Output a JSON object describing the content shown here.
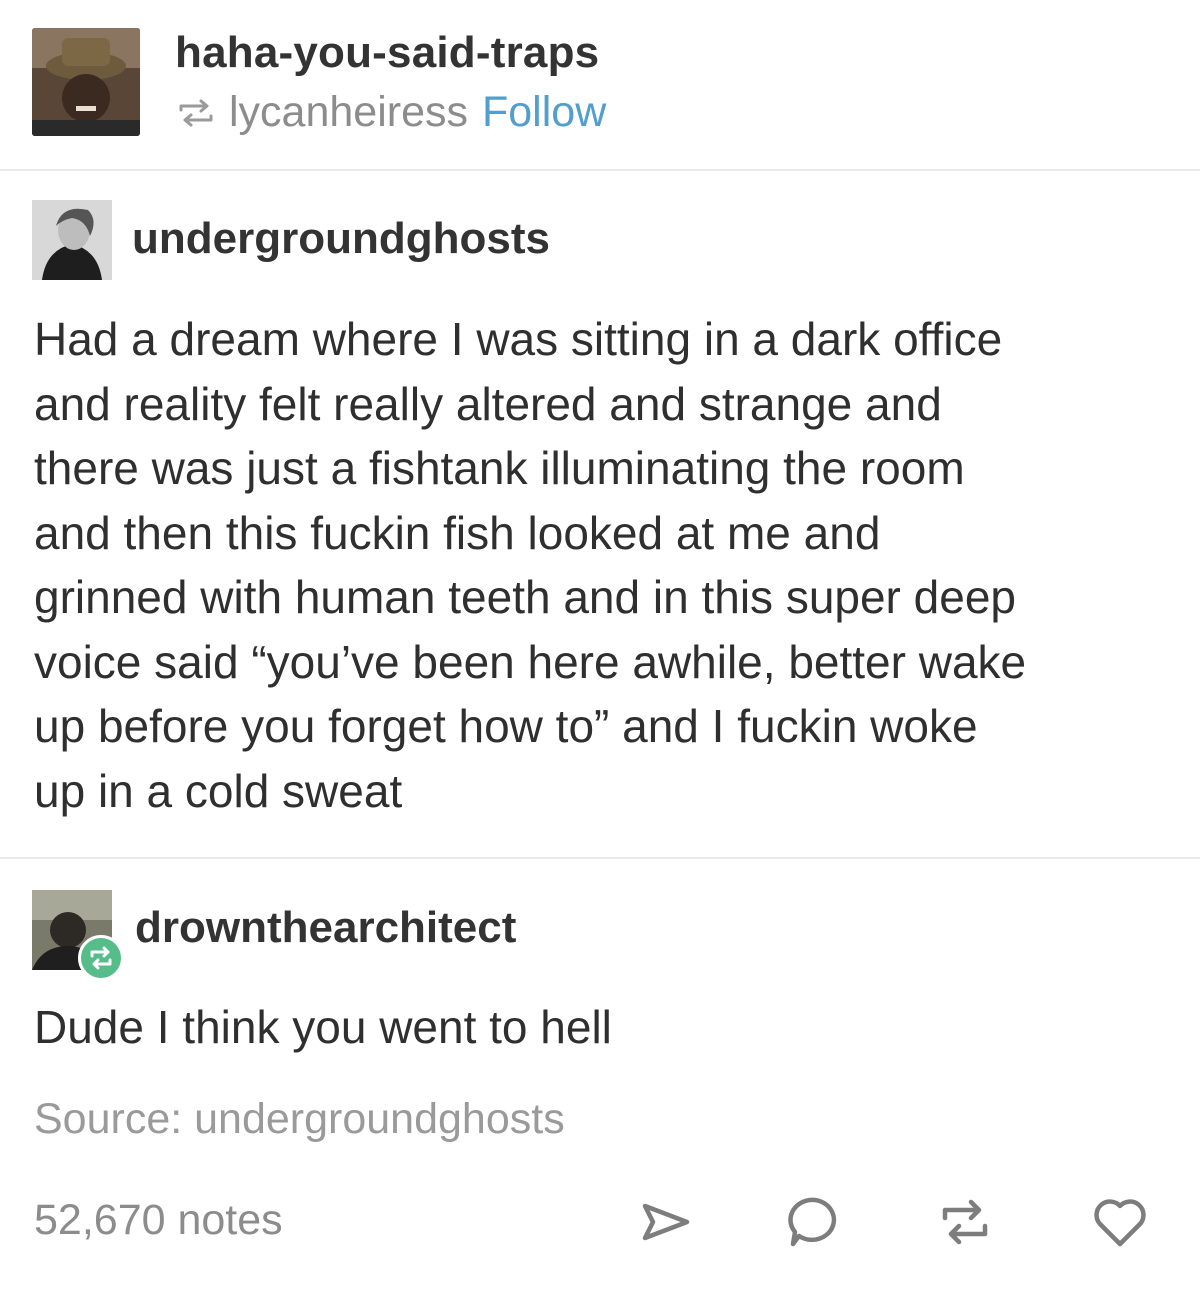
{
  "header": {
    "blog_name": "haha-you-said-traps",
    "reblogged_from": "lycanheiress",
    "follow_label": "Follow",
    "avatar_icon": "user-avatar-icon",
    "reblog_icon": "reblog-small-icon"
  },
  "posts": [
    {
      "username": "undergroundghosts",
      "avatar_icon": "user-avatar-icon",
      "text_lines": [
        "Had a dream where I was sitting in a dark office",
        "and reality felt really altered and strange and",
        "there was just a fishtank illuminating the room",
        "and then this fuckin fish looked at me and",
        "grinned with human teeth and in this super deep",
        "voice said “you’ve been here awhile, better wake",
        "up before you forget how to” and I fuckin woke",
        "up in a cold sweat"
      ]
    },
    {
      "username": "drownthearchitect",
      "avatar_icon": "user-avatar-icon",
      "badge_icon": "reblog-badge-icon",
      "text_lines": [
        "Dude I think you went to hell"
      ]
    }
  ],
  "source": "Source: undergroundghosts",
  "footer": {
    "notes": "52,670 notes",
    "actions": [
      {
        "icon": "share-icon"
      },
      {
        "icon": "reply-icon"
      },
      {
        "icon": "reblog-icon"
      },
      {
        "icon": "like-heart-icon"
      }
    ]
  },
  "colors": {
    "link": "#529ecc",
    "muted": "#8c8c8c",
    "text": "#2f2f2f",
    "badge": "#56bc8a",
    "divider": "#e9e9e9"
  }
}
